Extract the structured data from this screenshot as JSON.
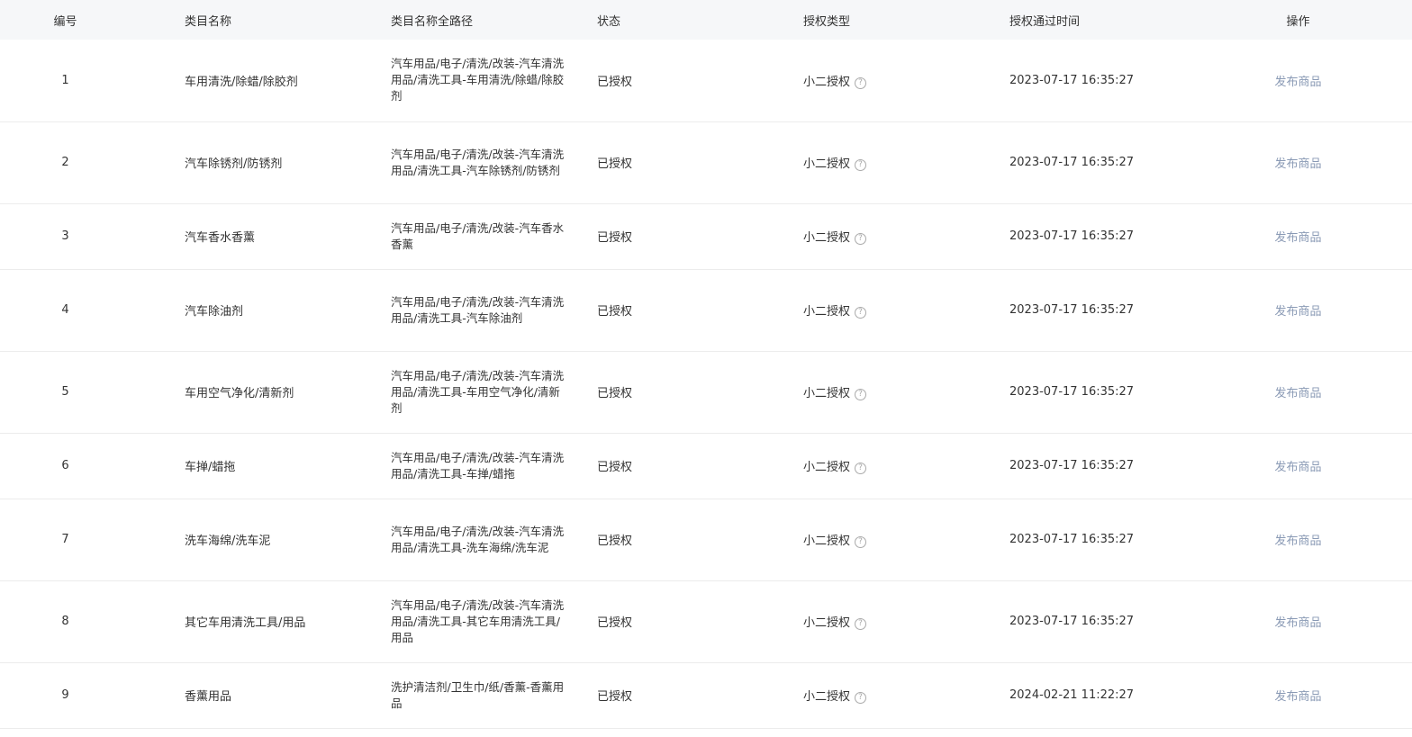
{
  "table": {
    "headers": {
      "index": "编号",
      "name": "类目名称",
      "path": "类目名称全路径",
      "status": "状态",
      "auth_type": "授权类型",
      "auth_time": "授权通过时间",
      "action": "操作"
    },
    "rows": [
      {
        "index": "1",
        "name": "车用清洗/除蜡/除胶剂",
        "path": "汽车用品/电子/清洗/改装-汽车清洗用品/清洗工具-车用清洗/除蜡/除胶剂",
        "status": "已授权",
        "auth_type": "小二授权",
        "auth_time": "2023-07-17 16:35:27",
        "action": "发布商品"
      },
      {
        "index": "2",
        "name": "汽车除锈剂/防锈剂",
        "path": "汽车用品/电子/清洗/改装-汽车清洗用品/清洗工具-汽车除锈剂/防锈剂",
        "status": "已授权",
        "auth_type": "小二授权",
        "auth_time": "2023-07-17 16:35:27",
        "action": "发布商品"
      },
      {
        "index": "3",
        "name": "汽车香水香薰",
        "path": "汽车用品/电子/清洗/改装-汽车香水香薰",
        "status": "已授权",
        "auth_type": "小二授权",
        "auth_time": "2023-07-17 16:35:27",
        "action": "发布商品"
      },
      {
        "index": "4",
        "name": "汽车除油剂",
        "path": "汽车用品/电子/清洗/改装-汽车清洗用品/清洗工具-汽车除油剂",
        "status": "已授权",
        "auth_type": "小二授权",
        "auth_time": "2023-07-17 16:35:27",
        "action": "发布商品"
      },
      {
        "index": "5",
        "name": "车用空气净化/清新剂",
        "path": "汽车用品/电子/清洗/改装-汽车清洗用品/清洗工具-车用空气净化/清新剂",
        "status": "已授权",
        "auth_type": "小二授权",
        "auth_time": "2023-07-17 16:35:27",
        "action": "发布商品"
      },
      {
        "index": "6",
        "name": "车掸/蜡拖",
        "path": "汽车用品/电子/清洗/改装-汽车清洗用品/清洗工具-车掸/蜡拖",
        "status": "已授权",
        "auth_type": "小二授权",
        "auth_time": "2023-07-17 16:35:27",
        "action": "发布商品"
      },
      {
        "index": "7",
        "name": "洗车海绵/洗车泥",
        "path": "汽车用品/电子/清洗/改装-汽车清洗用品/清洗工具-洗车海绵/洗车泥",
        "status": "已授权",
        "auth_type": "小二授权",
        "auth_time": "2023-07-17 16:35:27",
        "action": "发布商品"
      },
      {
        "index": "8",
        "name": "其它车用清洗工具/用品",
        "path": "汽车用品/电子/清洗/改装-汽车清洗用品/清洗工具-其它车用清洗工具/用品",
        "status": "已授权",
        "auth_type": "小二授权",
        "auth_time": "2023-07-17 16:35:27",
        "action": "发布商品"
      },
      {
        "index": "9",
        "name": "香薰用品",
        "path": "洗护清洁剂/卫生巾/纸/香薰-香薰用品",
        "status": "已授权",
        "auth_type": "小二授权",
        "auth_time": "2024-02-21 11:22:27",
        "action": "发布商品"
      }
    ]
  },
  "icons": {
    "help": "question-circle-icon"
  },
  "colors": {
    "header_bg": "#f6f7f9",
    "link": "#8a9ab5",
    "divider": "#ececec"
  }
}
